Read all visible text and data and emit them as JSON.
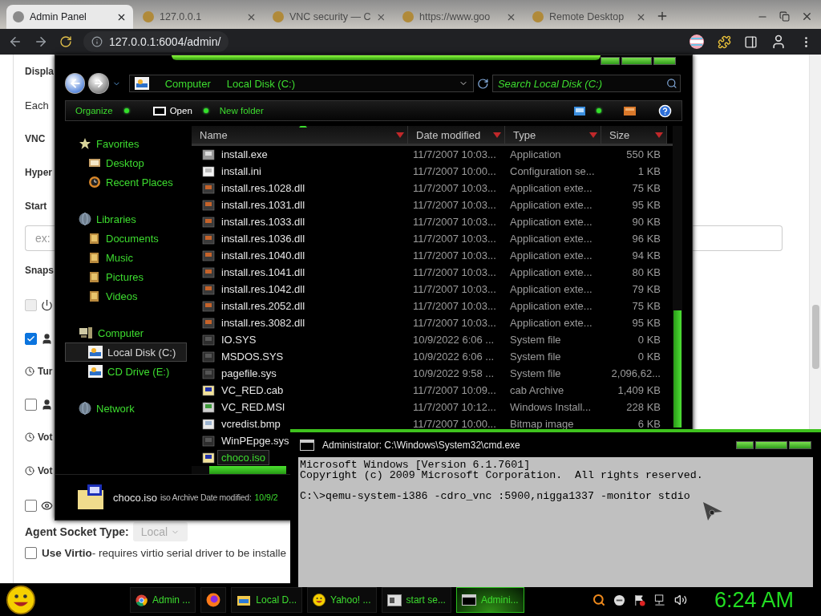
{
  "browser": {
    "tabs": [
      {
        "title": "Admin Panel",
        "selected": true
      },
      {
        "title": "127.0.0.1",
        "selected": false
      },
      {
        "title": "VNC security — C",
        "selected": false
      },
      {
        "title": "https://www.goo",
        "selected": false
      },
      {
        "title": "Remote Desktop",
        "selected": false
      }
    ],
    "address": "127.0.0.1:6004/admin/"
  },
  "page": {
    "items": [
      {
        "kind": "heading",
        "text": "Displa"
      },
      {
        "kind": "text",
        "text": "Each"
      },
      {
        "kind": "heading",
        "text": "VNC"
      },
      {
        "kind": "heading",
        "text": "Hyper"
      },
      {
        "kind": "heading",
        "text": "Start"
      },
      {
        "kind": "field",
        "placeholder": "ex:"
      },
      {
        "kind": "heading",
        "text": "Snaps"
      },
      {
        "kind": "power",
        "checked": false,
        "disabled": true
      },
      {
        "kind": "person",
        "checked": true,
        "disabled": false
      },
      {
        "kind": "clock",
        "text": "Tur"
      },
      {
        "kind": "person",
        "checked": false,
        "disabled": false
      },
      {
        "kind": "clock",
        "text": "Vot"
      },
      {
        "kind": "clock",
        "text": "Vot"
      },
      {
        "kind": "eye",
        "checked": false,
        "disabled": false
      },
      {
        "kind": "select",
        "label": "Agent Socket Type:",
        "value": "Local",
        "disabled": true
      },
      {
        "kind": "check",
        "checked": false,
        "disabled": false,
        "label": "Use Virtio",
        "text": "- requires virtio serial driver to be installe"
      }
    ]
  },
  "explorer": {
    "path": [
      "Computer",
      "Local Disk (C:)"
    ],
    "search": {
      "placeholder": "Search Local Disk (C:)"
    },
    "toolbar": [
      "Organize",
      "Open",
      "New folder"
    ],
    "nav": [
      {
        "label": "Favorites",
        "kind": "star",
        "selected": false,
        "children": [
          {
            "label": "Desktop",
            "kind": "desktop",
            "selected": false
          },
          {
            "label": "Recent Places",
            "kind": "recent",
            "selected": false
          }
        ]
      },
      {
        "label": "Libraries",
        "kind": "globe",
        "selected": false,
        "children": [
          {
            "label": "Documents",
            "kind": "folder",
            "selected": false
          },
          {
            "label": "Music",
            "kind": "folder",
            "selected": false
          },
          {
            "label": "Pictures",
            "kind": "folder",
            "selected": false
          },
          {
            "label": "Videos",
            "kind": "folder",
            "selected": false
          }
        ]
      },
      {
        "label": "Computer",
        "kind": "computer",
        "selected": false,
        "children": [
          {
            "label": "Local Disk (C:)",
            "kind": "drive",
            "selected": true
          },
          {
            "label": "CD Drive (E:)",
            "kind": "drive",
            "selected": false
          }
        ]
      },
      {
        "label": "Network",
        "kind": "globe",
        "selected": false
      }
    ],
    "columns": [
      "Name",
      "Date modified",
      "Type",
      "Size"
    ],
    "files": [
      {
        "name": "install.exe",
        "date": "11/7/2007 10:03...",
        "type": "Application",
        "size": "550 KB",
        "kind": "program",
        "selected": false
      },
      {
        "name": "install.ini",
        "date": "11/7/2007 10:00...",
        "type": "Configuration se...",
        "size": "1 KB",
        "kind": "text",
        "selected": false
      },
      {
        "name": "install.res.1028.dll",
        "date": "11/7/2007 10:03...",
        "type": "Application exte...",
        "size": "75 KB",
        "kind": "library",
        "selected": false
      },
      {
        "name": "install.res.1031.dll",
        "date": "11/7/2007 10:03...",
        "type": "Application exte...",
        "size": "95 KB",
        "kind": "library",
        "selected": false
      },
      {
        "name": "install.res.1033.dll",
        "date": "11/7/2007 10:03...",
        "type": "Application exte...",
        "size": "90 KB",
        "kind": "library",
        "selected": false
      },
      {
        "name": "install.res.1036.dll",
        "date": "11/7/2007 10:03...",
        "type": "Application exte...",
        "size": "96 KB",
        "kind": "library",
        "selected": false
      },
      {
        "name": "install.res.1040.dll",
        "date": "11/7/2007 10:03...",
        "type": "Application exte...",
        "size": "94 KB",
        "kind": "library",
        "selected": false
      },
      {
        "name": "install.res.1041.dll",
        "date": "11/7/2007 10:03...",
        "type": "Application exte...",
        "size": "80 KB",
        "kind": "library",
        "selected": false
      },
      {
        "name": "install.res.1042.dll",
        "date": "11/7/2007 10:03...",
        "type": "Application exte...",
        "size": "79 KB",
        "kind": "library",
        "selected": false
      },
      {
        "name": "install.res.2052.dll",
        "date": "11/7/2007 10:03...",
        "type": "Application exte...",
        "size": "75 KB",
        "kind": "library",
        "selected": false
      },
      {
        "name": "install.res.3082.dll",
        "date": "11/7/2007 10:03...",
        "type": "Application exte...",
        "size": "95 KB",
        "kind": "library",
        "selected": false
      },
      {
        "name": "IO.SYS",
        "date": "10/9/2022 6:06 ...",
        "type": "System file",
        "size": "0 KB",
        "kind": "system",
        "selected": false
      },
      {
        "name": "MSDOS.SYS",
        "date": "10/9/2022 6:06 ...",
        "type": "System file",
        "size": "0 KB",
        "kind": "system",
        "selected": false
      },
      {
        "name": "pagefile.sys",
        "date": "10/9/2022 9:58 ...",
        "type": "System file",
        "size": "2,096,62...",
        "kind": "system",
        "selected": false
      },
      {
        "name": "VC_RED.cab",
        "date": "11/7/2007 10:09...",
        "type": "cab Archive",
        "size": "1,409 KB",
        "kind": "archive",
        "selected": false
      },
      {
        "name": "VC_RED.MSI",
        "date": "11/7/2007 10:12...",
        "type": "Windows Install...",
        "size": "228 KB",
        "kind": "installer",
        "selected": false
      },
      {
        "name": "vcredist.bmp",
        "date": "11/7/2007 10:00...",
        "type": "Bitmap image",
        "size": "6 KB",
        "kind": "image",
        "selected": false
      },
      {
        "name": "WinPEpge.sys",
        "kind": "system",
        "selected": false
      },
      {
        "name": "choco.iso",
        "kind": "archive",
        "selected": true
      }
    ],
    "details": {
      "name": "choco.iso",
      "info": "iso Archive Date modified:",
      "date": "10/9/2"
    }
  },
  "console": {
    "title": "Administrator: C:\\Windows\\System32\\cmd.exe",
    "blocks": [
      [
        "Microsoft Windows [Version 6.1.7601]",
        "Copyright (c) 2009 Microsoft Corporation.  All rights reserved."
      ],
      [
        "C:\\>qemu-system-i386 -cdro_vnc :5900,nigga1337 -monitor stdio"
      ]
    ]
  },
  "taskbar": {
    "items": [
      {
        "label": "Admin ...",
        "kind": "chrome",
        "selected": false
      },
      {
        "kind": "firefox",
        "selected": false
      },
      {
        "label": "Local D...",
        "kind": "explorer",
        "selected": false
      },
      {
        "label": "Yahoo! ...",
        "kind": "yahoo",
        "selected": false
      },
      {
        "label": "start se...",
        "kind": "app",
        "selected": false
      },
      {
        "label": "Admini...",
        "kind": "console",
        "selected": true
      }
    ],
    "clock": "6:24 AM"
  }
}
